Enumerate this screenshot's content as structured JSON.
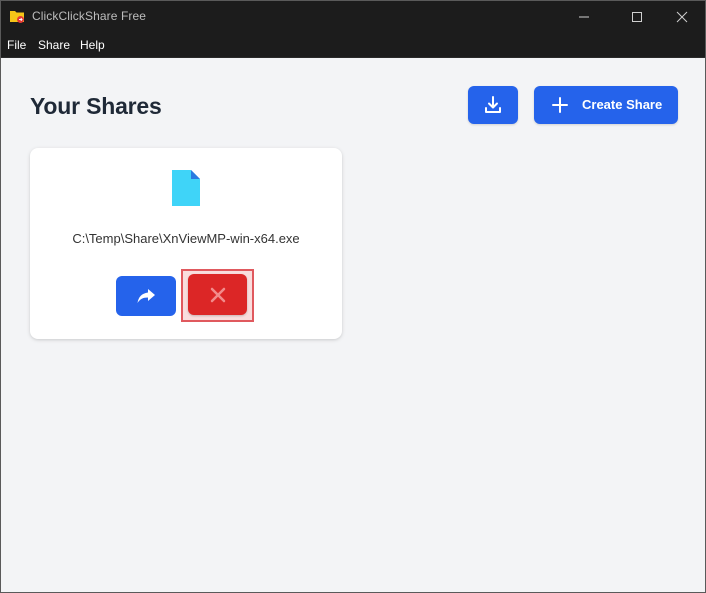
{
  "window": {
    "title": "ClickClickShare Free"
  },
  "menu": {
    "items": [
      "File",
      "Share",
      "Help"
    ]
  },
  "main": {
    "page_title": "Your Shares",
    "create_button_label": "Create Share"
  },
  "shares": [
    {
      "path": "C:\\Temp\\Share\\XnViewMP-win-x64.exe",
      "icon": "file-icon"
    }
  ],
  "colors": {
    "accent": "#2563eb",
    "danger": "#dc2626",
    "file_icon": "#3fd4f8",
    "background": "#f3f4f6",
    "titlebar": "#1c1c1c"
  }
}
